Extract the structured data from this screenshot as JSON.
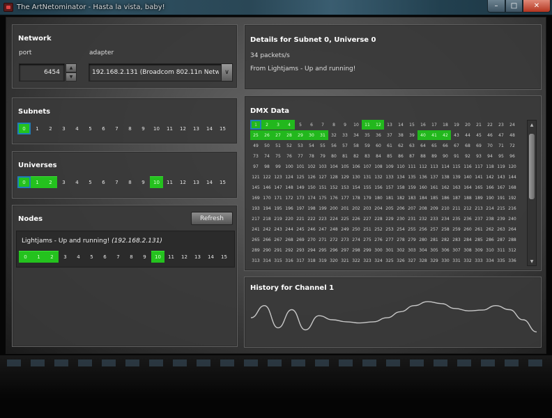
{
  "window": {
    "title": "The ArtNetominator - Hasta la vista, baby!",
    "minimize_glyph": "–",
    "maximize_glyph": "□",
    "close_glyph": "✕",
    "icon": "app-icon"
  },
  "network": {
    "title": "Network",
    "port_label": "port",
    "port_value": "6454",
    "adapter_label": "adapter",
    "adapter_value": "192.168.2.131 (Broadcom 802.11n Network Adapter)",
    "spin_up_glyph": "▲",
    "spin_down_glyph": "▼",
    "dropdown_glyph": "∨"
  },
  "subnets": {
    "title": "Subnets",
    "items": [
      "0",
      "1",
      "2",
      "3",
      "4",
      "5",
      "6",
      "7",
      "8",
      "9",
      "10",
      "11",
      "12",
      "13",
      "14",
      "15"
    ],
    "selected": [
      0
    ],
    "active": [
      0
    ]
  },
  "universes": {
    "title": "Universes",
    "items": [
      "0",
      "1",
      "2",
      "3",
      "4",
      "5",
      "6",
      "7",
      "8",
      "9",
      "10",
      "11",
      "12",
      "13",
      "14",
      "15"
    ],
    "selected": [
      0
    ],
    "active": [
      0,
      1,
      2,
      10
    ]
  },
  "nodes": {
    "title": "Nodes",
    "refresh_label": "Refresh",
    "node": {
      "name": "Lightjams - Up and running!",
      "address": "(192.168.2.131)",
      "items": [
        "0",
        "1",
        "2",
        "3",
        "4",
        "5",
        "6",
        "7",
        "8",
        "9",
        "10",
        "11",
        "12",
        "13",
        "14",
        "15"
      ],
      "active": [
        0,
        1,
        2,
        10
      ]
    }
  },
  "details": {
    "title": "Details for Subnet 0, Universe 0",
    "rate": "34 packets/s",
    "source": "From Lightjams - Up and running!"
  },
  "dmx": {
    "title": "DMX Data",
    "columns": 24,
    "first_channel": 1,
    "visible_rows": 14,
    "selected": [
      1
    ],
    "active": [
      1,
      2,
      3,
      4,
      11,
      12,
      25,
      26,
      27,
      28,
      29,
      30,
      31,
      40,
      41,
      42
    ],
    "scroll_up_glyph": "▲",
    "scroll_down_glyph": "▼",
    "scroll_position": 0.06,
    "scroll_visible_fraction": 0.52
  },
  "history": {
    "title": "History for Channel 1",
    "line_color": "#c8c8c8",
    "values": [
      0.55,
      0.85,
      0.3,
      0.75,
      0.25,
      0.6,
      0.5,
      0.45,
      0.42,
      0.45,
      0.55,
      0.7,
      0.85,
      0.95,
      0.9,
      0.78,
      0.72,
      0.74,
      0.85,
      0.75,
      0.5,
      0.2
    ]
  },
  "colors": {
    "active_cell": "#24c21e",
    "selected_outline": "#1e7fb8"
  }
}
